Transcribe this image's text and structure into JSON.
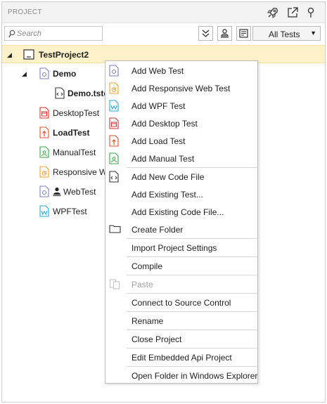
{
  "panel": {
    "title": "PROJECT",
    "header_icons": [
      "rocket-icon",
      "external-open-icon",
      "pin-icon"
    ]
  },
  "toolbar": {
    "search_placeholder": "Search",
    "buttons": [
      "collapse-all-icon",
      "user-filter-icon",
      "notes-icon"
    ],
    "filter_value": "All Tests"
  },
  "tree": {
    "project": "TestProject2",
    "demo_folder": "Demo",
    "demo_file": "Demo.tste",
    "items": {
      "desktop": "DesktopTest",
      "load": "LoadTest",
      "manual": "ManualTest",
      "responsive": "Responsive We",
      "web": "WebTest",
      "wpf": "WPFTest"
    }
  },
  "context_menu": {
    "add_web_test": "Add Web Test",
    "add_responsive_web_test": "Add Responsive Web Test",
    "add_wpf_test": "Add WPF Test",
    "add_desktop_test": "Add Desktop Test",
    "add_load_test": "Add Load Test",
    "add_manual_test": "Add Manual Test",
    "add_new_code_file": "Add New Code File",
    "add_existing_test": "Add Existing Test...",
    "add_existing_code_file": "Add Existing Code File...",
    "create_folder": "Create Folder",
    "import_project_settings": "Import Project Settings",
    "compile": "Compile",
    "paste": "Paste",
    "connect_source_control": "Connect to Source Control",
    "rename": "Rename",
    "close_project": "Close Project",
    "edit_embedded_api_project": "Edit Embedded Api Project",
    "open_folder_explorer": "Open Folder in Windows Explorer"
  },
  "colors": {
    "selection": "#fdf1c9",
    "web": "#7a7fc4",
    "responsive": "#f0a030",
    "wpf": "#2aa7d8",
    "desktop": "#d9332b",
    "load": "#e0522a",
    "manual": "#3aa54a",
    "code": "#333333"
  }
}
